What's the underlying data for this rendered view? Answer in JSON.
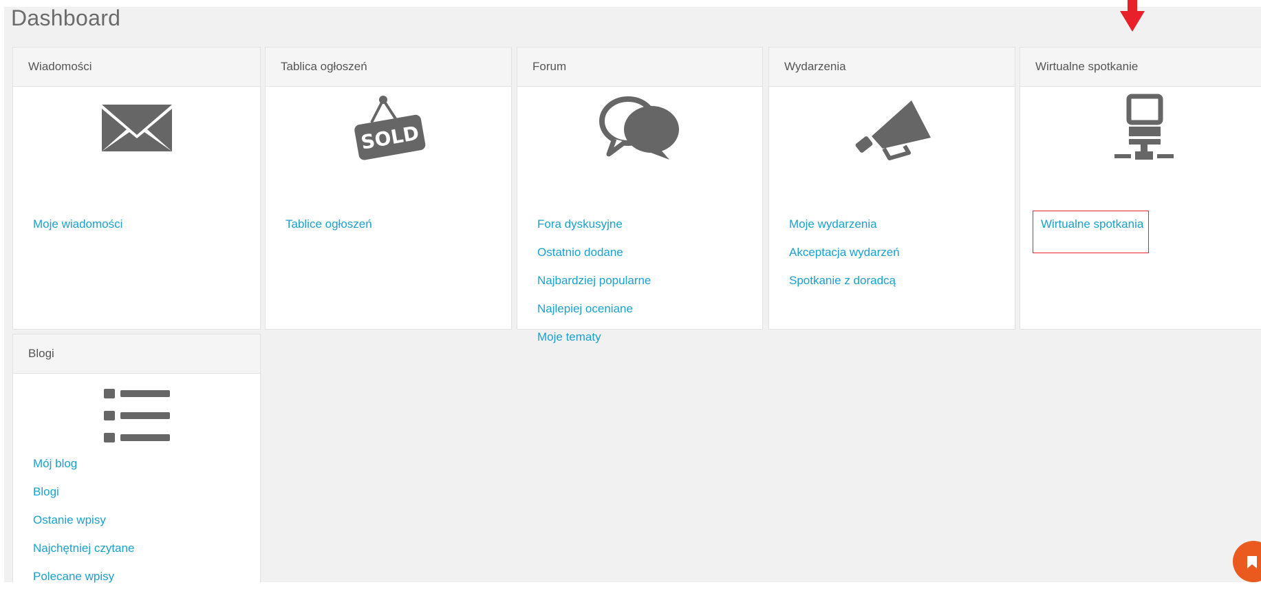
{
  "page": {
    "title": "Dashboard"
  },
  "panels": {
    "messages": {
      "header": "Wiadomości",
      "icon": "envelope-icon",
      "links": [
        "Moje wiadomości"
      ]
    },
    "classifieds": {
      "header": "Tablica ogłoszeń",
      "icon": "sold-sign-icon",
      "sign_text": "SOLD",
      "links": [
        "Tablice ogłoszeń"
      ]
    },
    "forum": {
      "header": "Forum",
      "icon": "speech-bubbles-icon",
      "links": [
        "Fora dyskusyjne",
        "Ostatnio dodane",
        "Najbardziej popularne",
        "Najlepiej oceniane",
        "Moje tematy"
      ]
    },
    "events": {
      "header": "Wydarzenia",
      "icon": "megaphone-icon",
      "links": [
        "Moje wydarzenia",
        "Akceptacja wydarzeń",
        "Spotkanie z doradcą"
      ]
    },
    "virtual_meeting": {
      "header": "Wirtualne spotkanie",
      "icon": "network-computer-icon",
      "links": [
        "Wirtualne spotkania"
      ]
    },
    "blogs": {
      "header": "Blogi",
      "icon": "list-icon",
      "links": [
        "Mój blog",
        "Blogi",
        "Ostanie wpisy",
        "Najchętniej czytane",
        "Polecane wpisy"
      ]
    }
  },
  "annotations": {
    "arrow_color": "#e8202a",
    "highlight_color": "#e8202a"
  },
  "colors": {
    "link": "#1aa1cf",
    "icon": "#666666",
    "fab": "#ea5a1e"
  }
}
